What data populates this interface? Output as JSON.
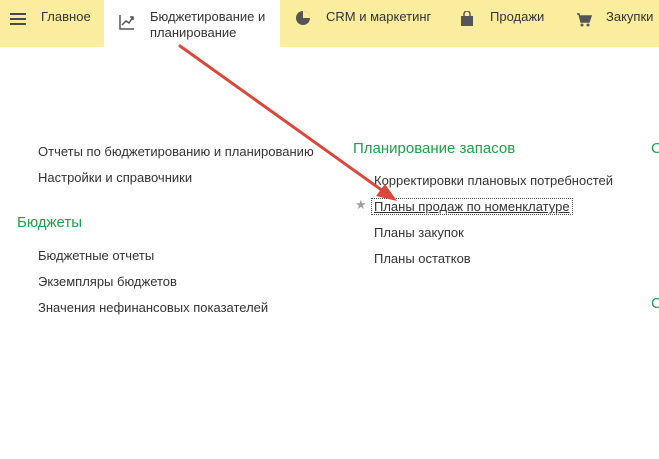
{
  "tabs": [
    {
      "label": "Главное"
    },
    {
      "label": "Бюджетирование и\nпланирование"
    },
    {
      "label": "CRM и маркетинг"
    },
    {
      "label": "Продажи"
    },
    {
      "label": "Закупки"
    }
  ],
  "left_column": {
    "items_top": [
      {
        "label": "Отчеты по бюджетированию и планированию"
      },
      {
        "label": "Настройки и справочники"
      }
    ],
    "section_title": "Бюджеты",
    "items": [
      {
        "label": "Бюджетные отчеты"
      },
      {
        "label": "Экземпляры бюджетов"
      },
      {
        "label": "Значения нефинансовых показателей"
      }
    ]
  },
  "middle_column": {
    "section_title": "Планирование запасов",
    "items": [
      {
        "label": "Корректировки плановых потребностей"
      },
      {
        "label": "Планы продаж по номенклатуре"
      },
      {
        "label": "Планы закупок"
      },
      {
        "label": "Планы остатков"
      }
    ]
  },
  "right_column": {
    "partial_title_1": "С",
    "partial_title_2": "С"
  },
  "colors": {
    "topbar": "#fbed9e",
    "section_green": "#1e9f4a",
    "arrow_red": "#d9483b"
  }
}
